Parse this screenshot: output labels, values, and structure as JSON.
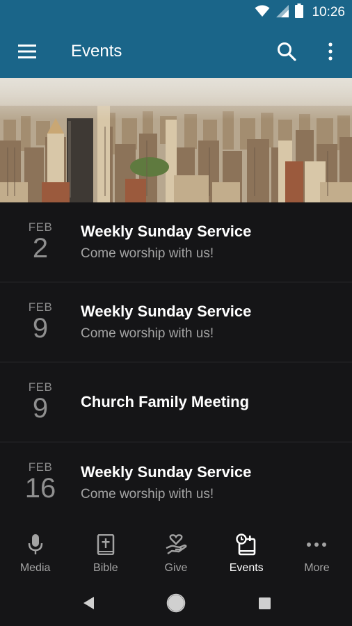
{
  "status_bar": {
    "time": "10:26",
    "icons": [
      "wifi-icon",
      "signal-icon",
      "battery-icon"
    ]
  },
  "app_bar": {
    "title": "Events",
    "icons": [
      "menu-icon",
      "search-icon",
      "more-vert-icon"
    ]
  },
  "hero": {
    "alt": "city skyline photo"
  },
  "events": [
    {
      "month": "FEB",
      "day": "2",
      "title": "Weekly Sunday Service",
      "subtitle": "Come worship with us!"
    },
    {
      "month": "FEB",
      "day": "9",
      "title": "Weekly Sunday Service",
      "subtitle": "Come worship with us!"
    },
    {
      "month": "FEB",
      "day": "9",
      "title": "Church Family Meeting",
      "subtitle": ""
    },
    {
      "month": "FEB",
      "day": "16",
      "title": "Weekly Sunday Service",
      "subtitle": "Come worship with us!"
    }
  ],
  "bottom_nav": {
    "items": [
      {
        "label": "Media",
        "icon": "microphone-icon"
      },
      {
        "label": "Bible",
        "icon": "bible-icon"
      },
      {
        "label": "Give",
        "icon": "give-icon"
      },
      {
        "label": "Events",
        "icon": "events-icon",
        "active": true
      },
      {
        "label": "More",
        "icon": "more-horiz-icon"
      }
    ]
  },
  "colors": {
    "primary": "#1a6589",
    "background": "#151517",
    "divider": "#2c2c2f",
    "text_secondary": "#a5a5a5"
  }
}
